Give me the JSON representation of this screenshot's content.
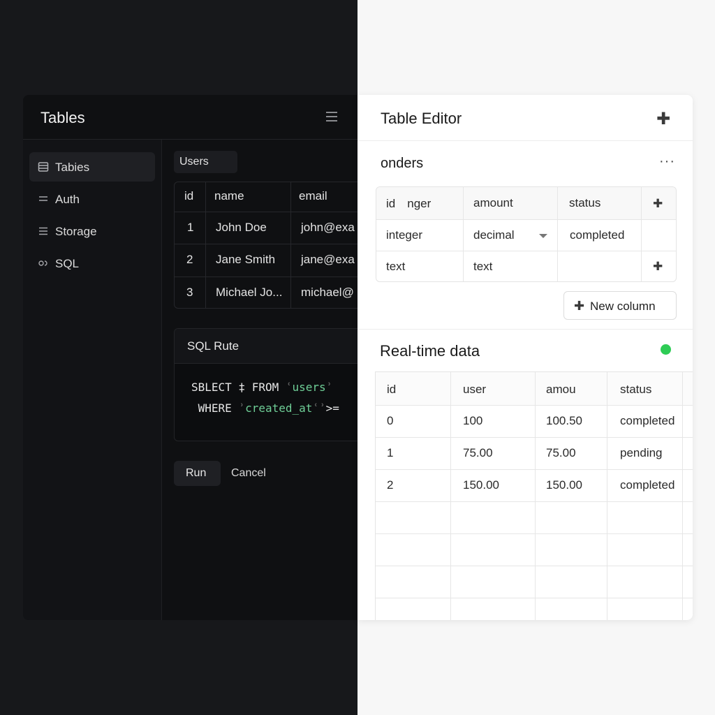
{
  "dark": {
    "title": "Tables",
    "sidebar": [
      {
        "label": "Tabies",
        "icon": "database-icon",
        "active": true
      },
      {
        "label": "Auth",
        "icon": "menu-icon",
        "active": false
      },
      {
        "label": "Storage",
        "icon": "menu-icon",
        "active": false
      },
      {
        "label": "SQL",
        "icon": "link-icon",
        "active": false
      }
    ],
    "users_tab": "Users",
    "users_table": {
      "headers": [
        "id",
        "name",
        "email"
      ],
      "rows": [
        [
          "1",
          "John Doe",
          "john@exa"
        ],
        [
          "2",
          "Jane Smith",
          "jane@exa"
        ],
        [
          "3",
          "Michael Jo...",
          "michael@"
        ]
      ]
    },
    "sql": {
      "title": "SQL Rute",
      "line1_a": "SBLECT ",
      "line1_b": "‡",
      "line1_c": " FROM ",
      "line1_d": "ʿ",
      "line1_e": "users",
      "line1_f": "ʾ",
      "line2_a": " WHERE ",
      "line2_b": "ʾ",
      "line2_c": "created_at",
      "line2_d": "ʿʾ",
      "line2_e": ">="
    },
    "run_label": "Run",
    "cancel_label": "Cancel"
  },
  "light": {
    "title": "Table Editor",
    "table_name": "onders",
    "schema": {
      "headers": [
        "id     nger",
        "amount",
        "status"
      ],
      "rows": [
        [
          "integer",
          "decimal",
          "completed"
        ],
        [
          "text",
          "text",
          ""
        ]
      ]
    },
    "new_column_label": "New column",
    "realtime": {
      "title": "Real-time data",
      "status_color": "#2ecc55",
      "headers": [
        "id",
        "user",
        "amou",
        "status"
      ],
      "rows": [
        [
          "0",
          "100",
          "100.50",
          "completed"
        ],
        [
          "1",
          "75.00",
          "75.00",
          "pending"
        ],
        [
          "2",
          "150.00",
          "150.00",
          "completed"
        ]
      ]
    }
  }
}
